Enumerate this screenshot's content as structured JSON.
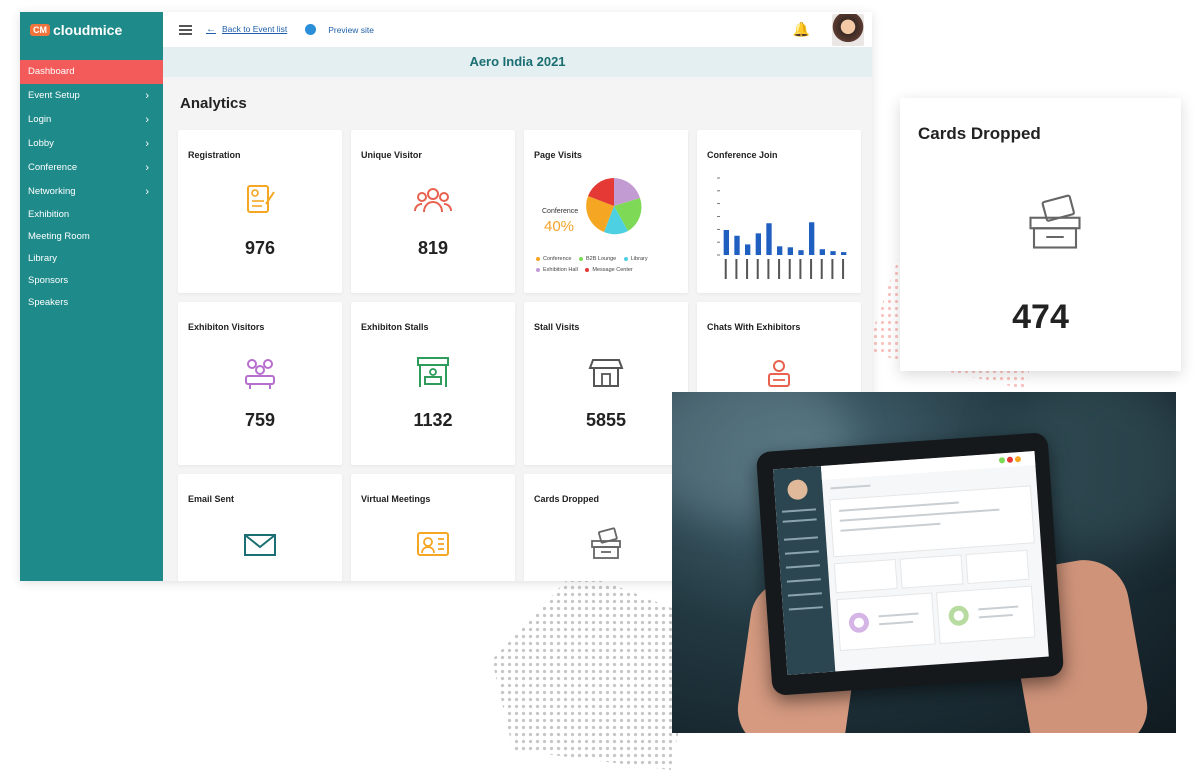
{
  "app": {
    "brand": "cloudmice",
    "brand_mark": "CM"
  },
  "sidebar": {
    "items": [
      {
        "label": "Dashboard",
        "active": true,
        "has_submenu": false
      },
      {
        "label": "Event Setup",
        "has_submenu": true
      },
      {
        "label": "Login",
        "has_submenu": true
      },
      {
        "label": "Lobby",
        "has_submenu": true
      },
      {
        "label": "Conference",
        "has_submenu": true
      },
      {
        "label": "Networking",
        "has_submenu": true
      },
      {
        "label": "Exhibition",
        "has_submenu": false
      },
      {
        "label": "Meeting Room",
        "has_submenu": false
      },
      {
        "label": "Library",
        "has_submenu": false
      },
      {
        "label": "Sponsors",
        "has_submenu": false
      },
      {
        "label": "Speakers",
        "has_submenu": false
      }
    ],
    "chevron": "›"
  },
  "topbar": {
    "back_arrow": "←",
    "back_label": "Back to Event list",
    "preview_label": "Preview site",
    "bell_icon": "🔔"
  },
  "event": {
    "title": "Aero India 2021"
  },
  "main": {
    "heading": "Analytics"
  },
  "cards": [
    {
      "title": "Registration",
      "value": "976",
      "icon": "registration-form-icon"
    },
    {
      "title": "Unique Visitor",
      "value": "819",
      "icon": "visitors-group-icon"
    },
    {
      "title": "Page Visits",
      "icon": "pie-chart"
    },
    {
      "title": "Conference Join",
      "icon": "bar-chart"
    },
    {
      "title": "Exhibiton Visitors",
      "value": "759",
      "icon": "audience-icon"
    },
    {
      "title": "Exhibiton Stalls",
      "value": "1132",
      "icon": "stall-icon"
    },
    {
      "title": "Stall Visits",
      "value": "5855",
      "icon": "shop-icon"
    },
    {
      "title": "Chats With Exhibitors",
      "icon": "chat-person-icon"
    },
    {
      "title": "Email Sent",
      "icon": "envelope-icon"
    },
    {
      "title": "Virtual Meetings",
      "icon": "video-meeting-icon"
    },
    {
      "title": "Cards Dropped",
      "icon": "card-box-icon"
    }
  ],
  "page_visits": {
    "highlight_label": "Conference",
    "highlight_pct": "40%",
    "legend": [
      {
        "label": "Conference",
        "color": "#f5a623"
      },
      {
        "label": "B2B Lounge",
        "color": "#7ed957"
      },
      {
        "label": "Library",
        "color": "#4dd0e1"
      },
      {
        "label": "Exhibition Hall",
        "color": "#c39bd3"
      },
      {
        "label": "Message Center",
        "color": "#e53935"
      }
    ]
  },
  "chart_data": {
    "type": "bar",
    "title": "Conference Join",
    "values": [
      52,
      40,
      22,
      45,
      66,
      18,
      16,
      10,
      68,
      12,
      8,
      6
    ],
    "ylim": [
      0,
      160
    ],
    "color": "#1f5fbf"
  },
  "floating_card": {
    "title": "Cards Dropped",
    "value": "474",
    "icon": "card-box-icon"
  }
}
